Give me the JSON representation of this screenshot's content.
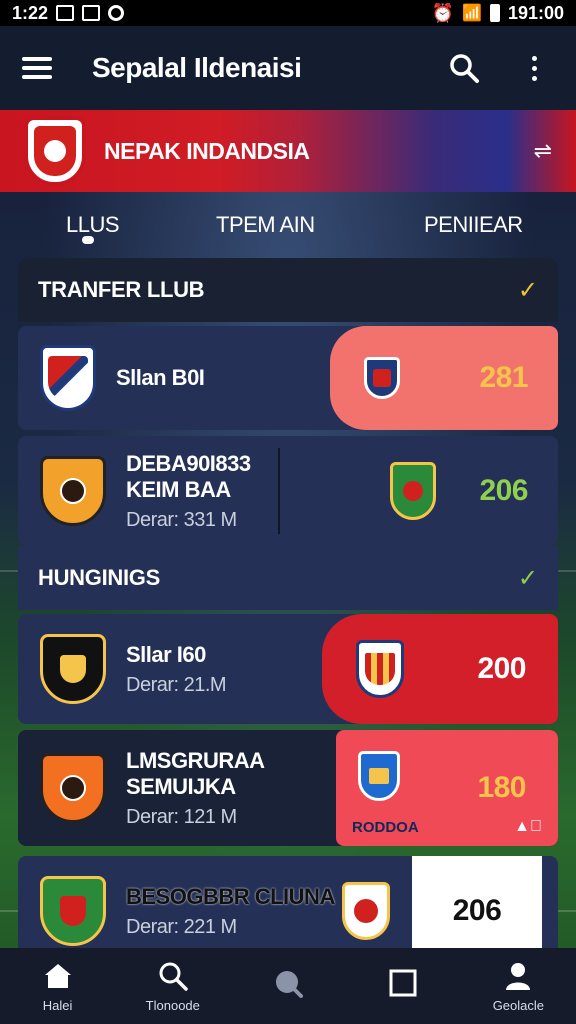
{
  "status_bar": {
    "time": "1:22",
    "right_text": "191:00"
  },
  "app_bar": {
    "title": "Sepalal Ildenaisi"
  },
  "banner": {
    "title": "NEPAK INDANDSIA",
    "action_icon": "swap-icon"
  },
  "tabs": [
    {
      "label": "LLUS",
      "active": true
    },
    {
      "label": "TPEM  AIN",
      "active": false
    },
    {
      "label": "PENIIEAR",
      "active": false
    }
  ],
  "sections": {
    "transfer": {
      "title": "TRANFER LLUB"
    },
    "hungings": {
      "title": "HUNGINIGS"
    }
  },
  "rows": [
    {
      "name": "Sllan B0I",
      "sub": "",
      "value": "281",
      "value_color": "#f4c54a"
    },
    {
      "name": "DEBA90I833\nKEIM BAA",
      "sub": "Derar: 331 M",
      "value": "206",
      "value_color": "#8fd14f"
    },
    {
      "name": "Sllar I60",
      "sub": "Derar: 21.M",
      "value": "200",
      "value_color": "#ffffff"
    },
    {
      "name": "LMSGRURAA\nSEMUIJKA",
      "sub": "Derar: 121 M",
      "value": "180",
      "value_color": "#f4c54a",
      "caption": "RODDOA"
    },
    {
      "name": "BESOGBBR\nCLIUNA",
      "sub": "Derar: 221 M",
      "value": "206",
      "value_color": "#111111"
    }
  ],
  "bottom_nav": [
    {
      "label": "Halei",
      "icon": "home-icon"
    },
    {
      "label": "Tlonoode",
      "icon": "search-icon"
    },
    {
      "label": "",
      "icon": "chat-icon"
    },
    {
      "label": "",
      "icon": "square-icon"
    },
    {
      "label": "Geolacle",
      "icon": "profile-icon"
    }
  ],
  "colors": {
    "app_bar": "#141c30",
    "banner_red": "#c8151f",
    "row_blue": "#243056",
    "pane_salmon": "#f2736e",
    "pane_red": "#d21f2a",
    "pane_coral": "#ef4a55",
    "pane_white": "#ffffff"
  }
}
